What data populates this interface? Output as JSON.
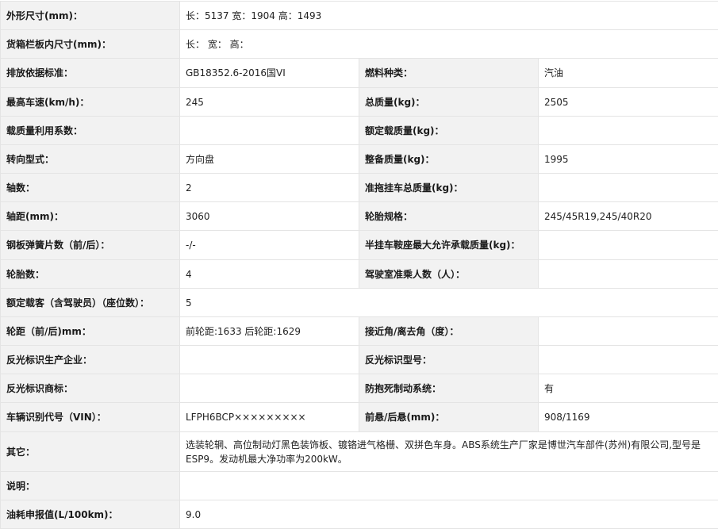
{
  "rows": {
    "dims": {
      "label": "外形尺寸(mm)：",
      "value": "长：5137 宽：1904 高：1493"
    },
    "cargo": {
      "label": "货箱栏板内尺寸(mm)：",
      "value": "长： 宽： 高："
    },
    "emission": {
      "label": "排放依据标准：",
      "value": "GB18352.6-2016国VI",
      "label2": "燃料种类：",
      "value2": "汽油"
    },
    "speed": {
      "label": "最高车速(km/h)：",
      "value": "245",
      "label2": "总质量(kg)：",
      "value2": "2505"
    },
    "loadfactor": {
      "label": "载质量利用系数：",
      "value": "",
      "label2": "额定载质量(kg)：",
      "value2": ""
    },
    "steering": {
      "label": "转向型式：",
      "value": "方向盘",
      "label2": "整备质量(kg)：",
      "value2": "1995"
    },
    "axles": {
      "label": "轴数：",
      "value": "2",
      "label2": "准拖挂车总质量(kg)：",
      "value2": ""
    },
    "wheelbase": {
      "label": "轴距(mm)：",
      "value": "3060",
      "label2": "轮胎规格：",
      "value2": "245/45R19,245/40R20"
    },
    "springs": {
      "label": "钢板弹簧片数（前/后）：",
      "value": "-/-",
      "label2": "半挂车鞍座最大允许承载质量(kg)：",
      "value2": ""
    },
    "tires": {
      "label": "轮胎数：",
      "value": "4",
      "label2": "驾驶室准乘人数（人）：",
      "value2": ""
    },
    "seats": {
      "label": "额定载客（含驾驶员）（座位数）：",
      "value": "5"
    },
    "track": {
      "label": "轮距（前/后)mm：",
      "value": "前轮距:1633 后轮距:1629",
      "label2": "接近角/离去角（度）：",
      "value2": ""
    },
    "reflector": {
      "label": "反光标识生产企业：",
      "value": "",
      "label2": "反光标识型号：",
      "value2": ""
    },
    "reflbrand": {
      "label": "反光标识商标：",
      "value": "",
      "label2": "防抱死制动系统：",
      "value2": "有"
    },
    "vin": {
      "label": "车辆识别代号（VIN）：",
      "value": "LFPH6BCP×××××××××",
      "label2": "前悬/后悬(mm)：",
      "value2": "908/1169"
    },
    "other": {
      "label": "其它：",
      "value": "选装轮辋、高位制动灯黑色装饰板、镀铬进气格栅、双拼色车身。ABS系统生产厂家是博世汽车部件(苏州)有限公司,型号是ESP9。发动机最大净功率为200kW。"
    },
    "notes": {
      "label": "说明：",
      "value": ""
    },
    "fuel": {
      "label": "油耗申报值(L/100km)：",
      "value": "9.0"
    }
  }
}
